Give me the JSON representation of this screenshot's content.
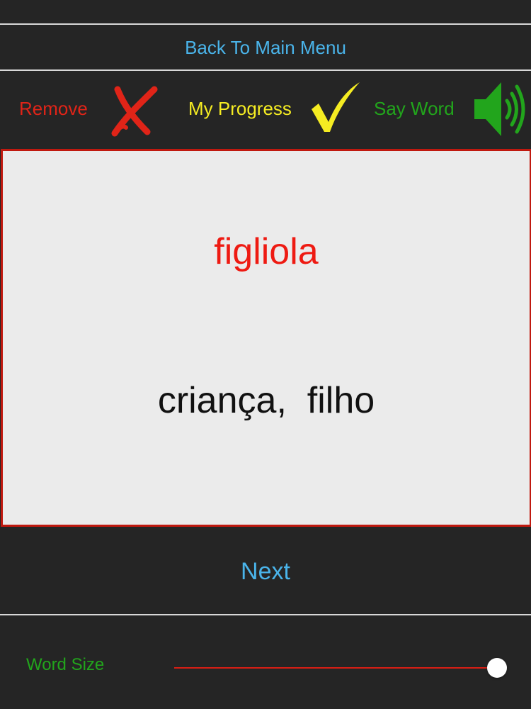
{
  "nav": {
    "back_label": "Back To Main Menu"
  },
  "toolbar": {
    "remove_label": "Remove",
    "progress_label": "My Progress",
    "say_word_label": "Say Word",
    "remove_icon": "cross-icon",
    "progress_icon": "checkmark-icon",
    "say_word_icon": "speaker-icon"
  },
  "card": {
    "word": "figliola",
    "translation": "criança,  filho"
  },
  "controls": {
    "next_label": "Next",
    "word_size_label": "Word Size",
    "word_size_value": 1.0
  },
  "colors": {
    "background": "#252525",
    "link_blue": "#4ab4ea",
    "remove_red": "#e02418",
    "progress_yellow": "#f5ec22",
    "say_green": "#22a51c",
    "card_background": "#ebebeb",
    "card_border": "#c0190f",
    "word_red": "#ee1a12",
    "slider_fill": "#d81e14"
  }
}
